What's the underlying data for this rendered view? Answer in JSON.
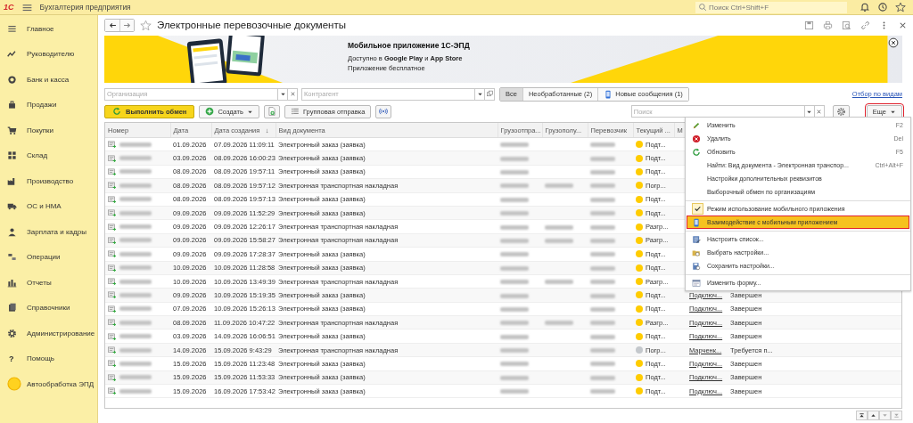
{
  "topbar": {
    "logo": "1С",
    "title": "Бухгалтерия предприятия",
    "search": {
      "placeholder": "Поиск Ctrl+Shift+F"
    }
  },
  "sidebar": {
    "items": [
      {
        "label": "Главное"
      },
      {
        "label": "Руководителю"
      },
      {
        "label": "Банк и касса"
      },
      {
        "label": "Продажи"
      },
      {
        "label": "Покупки"
      },
      {
        "label": "Склад"
      },
      {
        "label": "Производство"
      },
      {
        "label": "ОС и НМА"
      },
      {
        "label": "Зарплата и кадры"
      },
      {
        "label": "Операции"
      },
      {
        "label": "Отчеты"
      },
      {
        "label": "Справочники"
      },
      {
        "label": "Администрирование"
      },
      {
        "label": "Помощь",
        "glyph": "?"
      },
      {
        "label": "Автообработка ЭПД"
      }
    ]
  },
  "window": {
    "title": "Электронные перевозочные документы"
  },
  "banner": {
    "title": "Мобильное приложение 1С-ЭПД",
    "line": "Доступно в **Google Play** и **App Store**",
    "note": "Приложение бесплатное"
  },
  "filters": {
    "organization": {
      "placeholder": "Организация"
    },
    "counterparty": {
      "placeholder": "Контрагент"
    },
    "tabs": [
      {
        "label": "Все",
        "selected": true,
        "phone": false
      },
      {
        "label": "Необработанные (2)",
        "selected": false,
        "phone": false
      },
      {
        "label": "Новые сообщения (1)",
        "selected": false,
        "phone": true
      }
    ],
    "link": "Отбор по видам"
  },
  "toolbar": {
    "exchange": "Выполнить обмен",
    "create": "Создать",
    "group_send": "Групповая отправка",
    "search": {
      "placeholder": "Поиск"
    },
    "more": "Еще",
    "more_highlighted": true
  },
  "table": {
    "columns": [
      {
        "label": "Номер"
      },
      {
        "label": "Дата"
      },
      {
        "label": "Дата создания",
        "sort_mark": "↓"
      },
      {
        "label": "Вид документа"
      },
      {
        "label": "Грузоотпра..."
      },
      {
        "label": "Грузополу..."
      },
      {
        "label": "Перевозчик"
      },
      {
        "label": "Текущий ..."
      },
      {
        "label": "М"
      }
    ],
    "rows": [
      {
        "date": "01.09.2026",
        "created": "07.09.2026 11:09:11",
        "doc_type": "Электронный заказ (заявка)",
        "consignee_blurred": false,
        "status": "Подт...",
        "color": "#ffcc00"
      },
      {
        "date": "03.09.2026",
        "created": "08.09.2026 16:00:23",
        "doc_type": "Электронный заказ (заявка)",
        "consignee_blurred": false,
        "status": "Подт...",
        "color": "#ffcc00"
      },
      {
        "date": "08.09.2026",
        "created": "08.09.2026 19:57:11",
        "doc_type": "Электронный заказ (заявка)",
        "consignee_blurred": false,
        "status": "Подт...",
        "color": "#ffcc00"
      },
      {
        "date": "08.09.2026",
        "created": "08.09.2026 19:57:12",
        "doc_type": "Электронная транспортная накладная",
        "consignee_blurred": true,
        "status": "Погр...",
        "color": "#ffcc00"
      },
      {
        "date": "08.09.2026",
        "created": "08.09.2026 19:57:13",
        "doc_type": "Электронный заказ (заявка)",
        "consignee_blurred": false,
        "status": "Подт...",
        "color": "#ffcc00"
      },
      {
        "date": "09.09.2026",
        "created": "09.09.2026 11:52:29",
        "doc_type": "Электронный заказ (заявка)",
        "consignee_blurred": false,
        "status": "Подт...",
        "color": "#ffcc00"
      },
      {
        "date": "09.09.2026",
        "created": "09.09.2026 12:26:17",
        "doc_type": "Электронная транспортная накладная",
        "consignee_blurred": true,
        "status": "Разгр...",
        "color": "#ffcc00"
      },
      {
        "date": "09.09.2026",
        "created": "09.09.2026 15:58:27",
        "doc_type": "Электронная транспортная накладная",
        "consignee_blurred": true,
        "status": "Разгр...",
        "color": "#ffcc00"
      },
      {
        "date": "09.09.2026",
        "created": "09.09.2026 17:28:37",
        "doc_type": "Электронный заказ (заявка)",
        "consignee_blurred": false,
        "status": "Подт...",
        "color": "#ffcc00"
      },
      {
        "date": "10.09.2026",
        "created": "10.09.2026 11:28:58",
        "doc_type": "Электронный заказ (заявка)",
        "consignee_blurred": false,
        "status": "Подт...",
        "color": "#ffcc00"
      },
      {
        "date": "10.09.2026",
        "created": "10.09.2026 13:49:39",
        "doc_type": "Электронная транспортная накладная",
        "consignee_blurred": true,
        "status": "Разгр...",
        "color": "#ffcc00"
      },
      {
        "date": "09.09.2026",
        "created": "10.09.2026 15:19:35",
        "doc_type": "Электронный заказ (заявка)",
        "consignee_blurred": false,
        "status": "Подт...",
        "color": "#ffcc00",
        "link": "Подключ...",
        "state": "Завершен"
      },
      {
        "date": "07.09.2026",
        "created": "10.09.2026 15:26:13",
        "doc_type": "Электронный заказ (заявка)",
        "consignee_blurred": false,
        "status": "Подт...",
        "color": "#ffcc00",
        "link": "Подключ...",
        "state": "Завершен"
      },
      {
        "date": "08.09.2026",
        "created": "11.09.2026 10:47:22",
        "doc_type": "Электронная транспортная накладная",
        "consignee_blurred": true,
        "status": "Разгр...",
        "color": "#ffcc00",
        "link": "Подключ...",
        "state": "Завершен"
      },
      {
        "date": "03.09.2026",
        "created": "14.09.2026 16:06:51",
        "doc_type": "Электронный заказ (заявка)",
        "consignee_blurred": false,
        "status": "Подт...",
        "color": "#ffcc00",
        "link": "Подключ...",
        "state": "Завершен"
      },
      {
        "date": "14.09.2026",
        "created": "15.09.2026 9:43:29",
        "doc_type": "Электронная транспортная накладная",
        "consignee_blurred": false,
        "status": "Погр...",
        "color": "#c4c8cc",
        "link": "Марченк...",
        "state": "Требуется п..."
      },
      {
        "date": "15.09.2026",
        "created": "15.09.2026 11:23:48",
        "doc_type": "Электронный заказ (заявка)",
        "consignee_blurred": false,
        "status": "Подт...",
        "color": "#ffcc00",
        "link": "Подключ...",
        "state": "Завершен"
      },
      {
        "date": "15.09.2026",
        "created": "15.09.2026 11:53:33",
        "doc_type": "Электронный заказ (заявка)",
        "consignee_blurred": false,
        "status": "Подт...",
        "color": "#ffcc00",
        "link": "Подключ...",
        "state": "Завершен"
      },
      {
        "date": "15.09.2026",
        "created": "16.09.2026 17:53:42",
        "doc_type": "Электронный заказ (заявка)",
        "consignee_blurred": false,
        "status": "Подт...",
        "color": "#ffcc00",
        "link": "Подключ...",
        "state": "Завершен"
      }
    ]
  },
  "menu": {
    "items": [
      {
        "kind": "item",
        "label": "Изменить",
        "shortcut": "F2",
        "checked": false,
        "selected": false
      },
      {
        "kind": "item",
        "label": "Удалить",
        "shortcut": "Del",
        "checked": false,
        "selected": false
      },
      {
        "kind": "item",
        "label": "Обновить",
        "shortcut": "F5",
        "checked": false,
        "selected": false
      },
      {
        "kind": "item",
        "label": "Найти: Вид документа - Электронная транспор...",
        "shortcut": "Ctrl+Alt+F",
        "checked": false,
        "selected": false
      },
      {
        "kind": "item",
        "label": "Настройки дополнительных реквизитов",
        "checked": false,
        "selected": false
      },
      {
        "kind": "item",
        "label": "Выборочный обмен по организациям",
        "checked": false,
        "selected": false
      },
      {
        "kind": "separator"
      },
      {
        "kind": "item",
        "label": "Режим использование мобильного приложения",
        "checked": true,
        "selected": false
      },
      {
        "kind": "item",
        "label": "Взаимодействие с мобильным приложением",
        "checked": false,
        "selected": true
      },
      {
        "kind": "separator"
      },
      {
        "kind": "item",
        "label": "Настроить список...",
        "checked": false,
        "selected": false
      },
      {
        "kind": "item",
        "label": "Выбрать настройки...",
        "checked": false,
        "selected": false
      },
      {
        "kind": "item",
        "label": "Сохранить настройки...",
        "checked": false,
        "selected": false
      },
      {
        "kind": "separator"
      },
      {
        "kind": "item",
        "label": "Изменить форму...",
        "checked": false,
        "selected": false
      }
    ]
  }
}
